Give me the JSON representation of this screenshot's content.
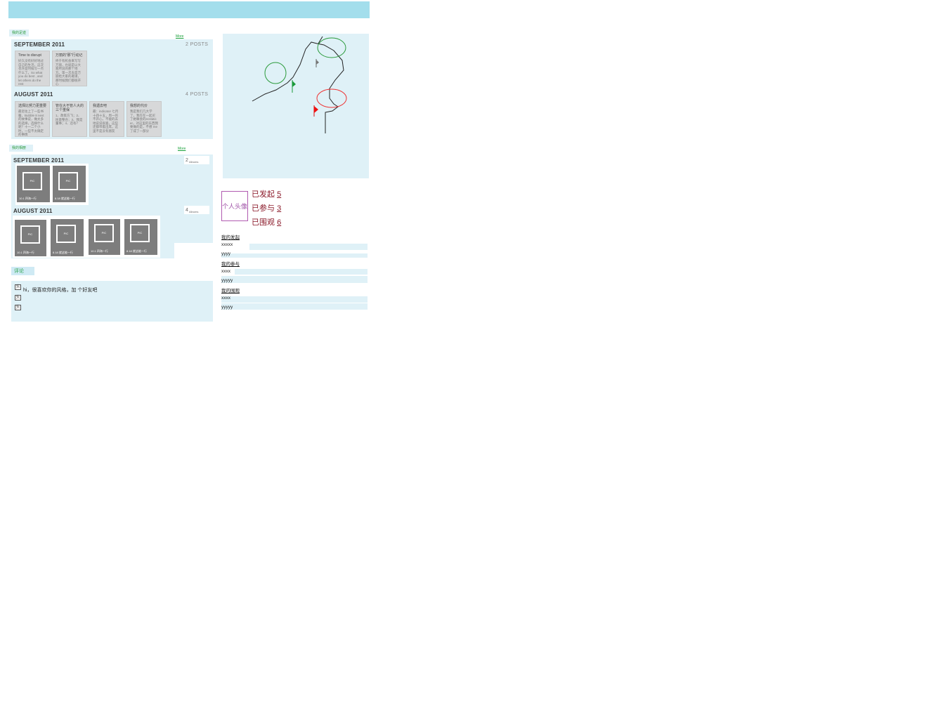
{
  "left": {
    "section1": {
      "label": "我的足迹",
      "more": "More",
      "groups": [
        {
          "month": "SEPTEMBER 2011",
          "count": "2 POSTS",
          "cards": [
            {
              "title": "Time to disrupt",
              "body": "好久没有好好地过自己的生活，这次也许是时候写一点什么了。So what you do best , and let others do the rest"
            },
            {
              "title": "万丽的\"那\"行动记",
              "body": "终于有机会来写写万丽，也就是以大家所说的那个地方。第一次去是万丽给大家的邀请，那时候我们都很开心"
            }
          ]
        },
        {
          "month": "AUGUST 2011",
          "count": "4 POSTS",
          "cards": [
            {
              "title": "选择比努力更重要",
              "body": "最近往上了一些书籍，Bubble 8 next的故事说，做太多的选择，选择什么呢？十一二个小时，一些不太确定的事情"
            },
            {
              "title": "管在大不管人大的三个重保",
              "body": "1、政策方飞；2、民意整合；3、我是董事；4、还有？"
            },
            {
              "title": "我遇去吧",
              "body": "最：indicator 七月十四十五，周一的不开心，不能的去地说说很喜，这些还都带着出席，这里不是没有朋友"
            },
            {
              "title": "我想的代价",
              "body": "我是我们几大学了，我在在一起买了她嘛会的ecstatic er，对这里的东西我要做的是，不想 me 了成了一部分"
            }
          ]
        }
      ]
    },
    "section2": {
      "label": "我的相册",
      "more": "More",
      "groups": [
        {
          "month": "SEPTEMBER 2011",
          "count": "2",
          "count_label": "Albums",
          "albums": [
            {
              "pic": "PIC",
              "caption": "10.1 四海一行"
            },
            {
              "pic": "PIC",
              "caption": "8.18 就这能一行"
            }
          ]
        },
        {
          "month": "AUGUST 2011",
          "count": "4",
          "count_label": "Albums",
          "albums": [
            {
              "pic": "PIC",
              "caption": "10.1 四海一行"
            },
            {
              "pic": "PIC",
              "caption": "8.18 就这能一行"
            },
            {
              "pic": "PIC",
              "caption": "10.1 四海一行"
            },
            {
              "pic": "PIC",
              "caption": "8.18 就这能一行"
            }
          ]
        }
      ]
    },
    "comments": {
      "title": "评论",
      "items": [
        {
          "icon": "头",
          "text": "hi，很喜欢你的风格，加 个好友吧"
        },
        {
          "icon": "头",
          "text": ""
        },
        {
          "icon": "头",
          "text": ""
        }
      ]
    }
  },
  "right": {
    "avatar": "个人头像",
    "stats": [
      {
        "label": "已发起",
        "value": "5"
      },
      {
        "label": "已参与",
        "value": "3"
      },
      {
        "label": "已围观",
        "value": "6"
      }
    ],
    "lists": [
      {
        "title": "我的发起",
        "items": [
          "xxxxx",
          "yyyy"
        ]
      },
      {
        "title": "我的参与",
        "items": [
          "xxxx",
          "yyyyy"
        ]
      },
      {
        "title": "我的围观",
        "items": [
          "xxxx",
          "yyyyy"
        ]
      }
    ]
  }
}
